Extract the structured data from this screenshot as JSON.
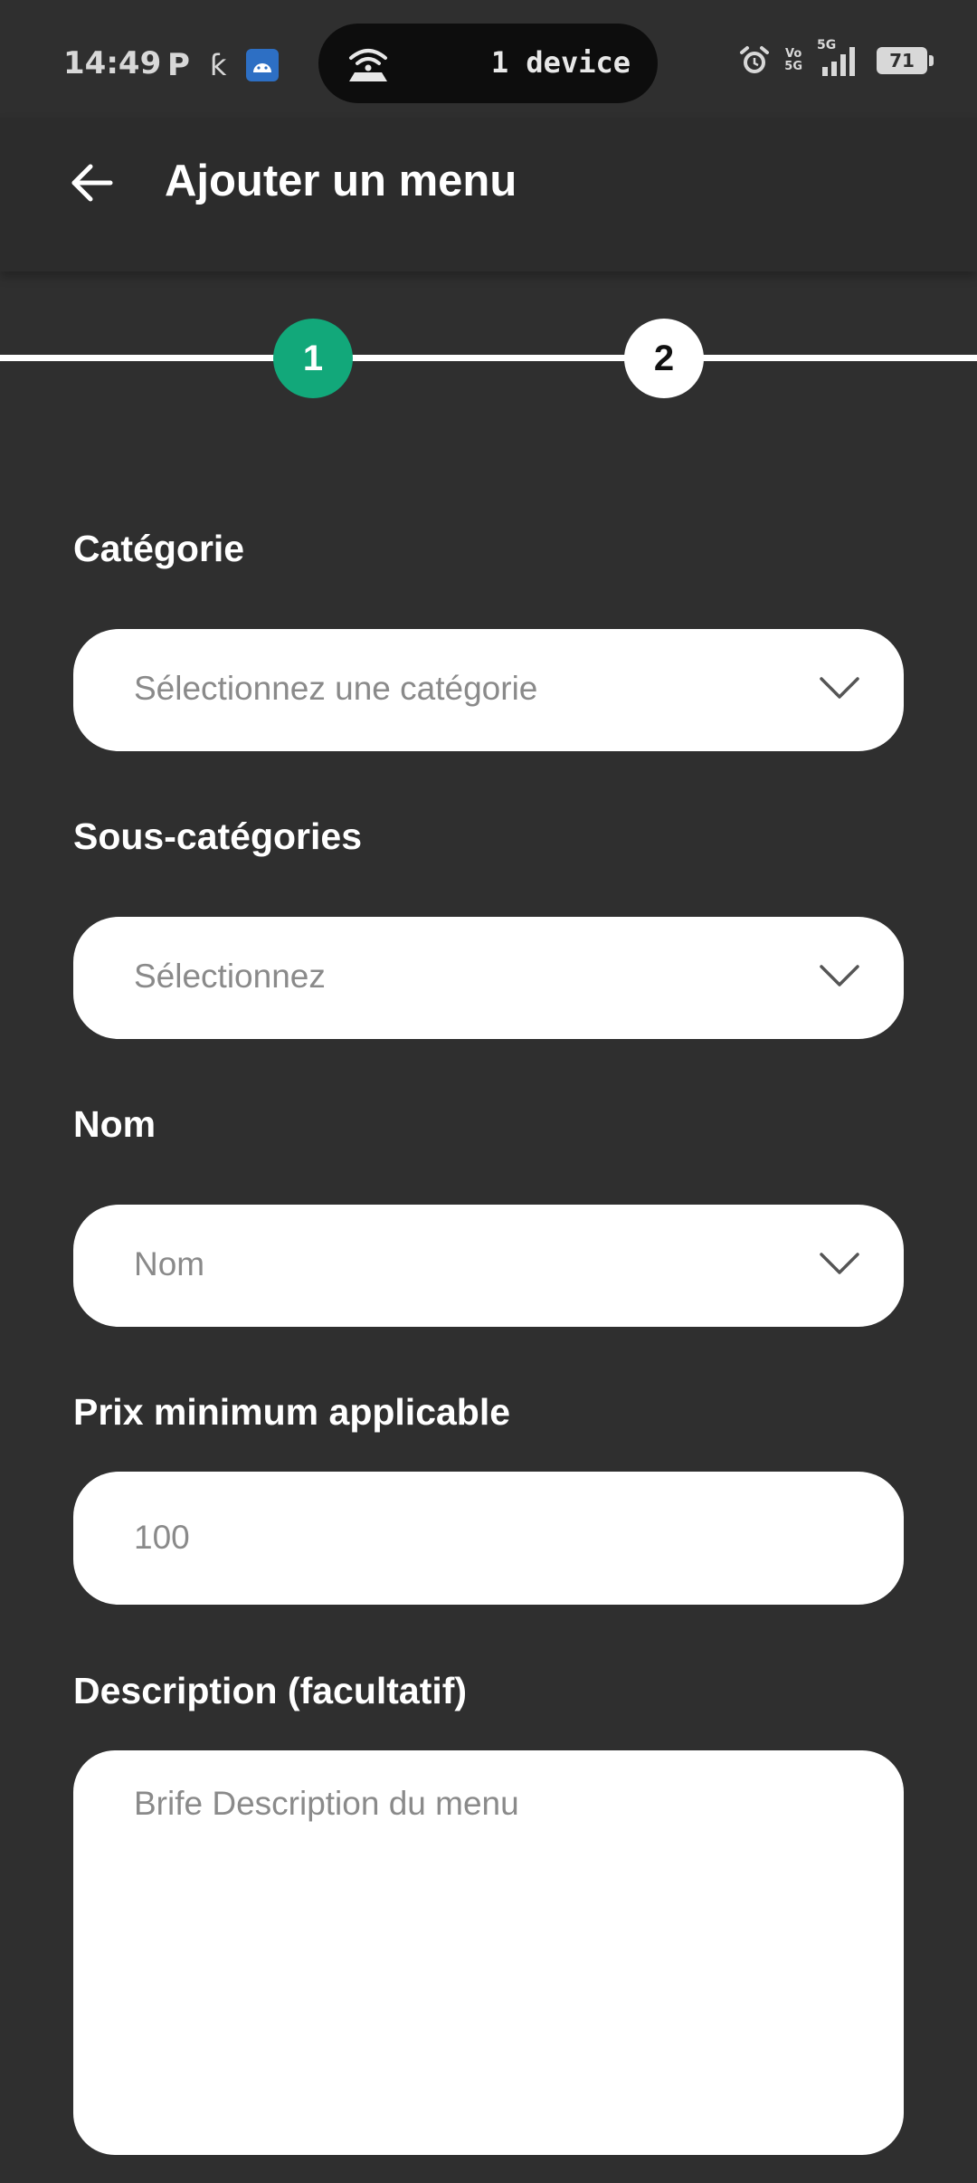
{
  "status_bar": {
    "time": "14:49",
    "left_icons": [
      "p-icon",
      "k-icon",
      "android-icon"
    ],
    "hotspot_text": "1 device",
    "right_icons": [
      "alarm-icon",
      "volte-icon",
      "5g-signal-icon",
      "battery-icon"
    ],
    "network": "5G",
    "volte_line1": "Vo",
    "volte_line2": "5G",
    "battery_level": "71"
  },
  "app_bar": {
    "title": "Ajouter un menu",
    "back_icon": "arrow-left-icon"
  },
  "stepper": {
    "steps": [
      {
        "number": "1",
        "active": true,
        "color": "#12a87a"
      },
      {
        "number": "2",
        "active": false,
        "color": "#ffffff"
      }
    ]
  },
  "form": {
    "category": {
      "label": "Catégorie",
      "placeholder": "Sélectionnez une catégorie",
      "icon": "chevron-down-icon"
    },
    "subcategories": {
      "label": "Sous-catégories",
      "placeholder": "Sélectionnez",
      "icon": "chevron-down-icon"
    },
    "name": {
      "label": "Nom",
      "placeholder": "Nom",
      "icon": "chevron-down-icon"
    },
    "min_price": {
      "label": "Prix minimum applicable",
      "placeholder": "100"
    },
    "description": {
      "label": "Description (facultatif)",
      "placeholder": "Brife Description du menu"
    }
  },
  "colors": {
    "background": "#2f2f2f",
    "accent": "#12a87a",
    "field_bg": "#ffffff",
    "placeholder": "#8a8a8a"
  }
}
